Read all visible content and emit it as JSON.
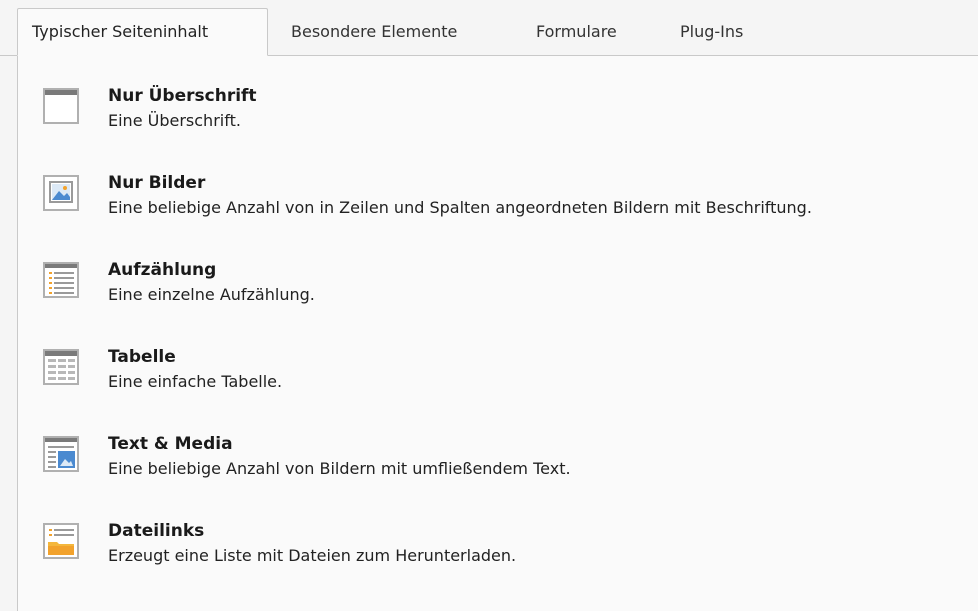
{
  "tabs": [
    {
      "label": "Typischer Seiteninhalt",
      "active": true
    },
    {
      "label": "Besondere Elemente",
      "active": false
    },
    {
      "label": "Formulare",
      "active": false
    },
    {
      "label": "Plug-Ins",
      "active": false
    }
  ],
  "items": [
    {
      "title": "Nur Überschrift",
      "description": "Eine Überschrift.",
      "icon": "header-icon"
    },
    {
      "title": "Nur Bilder",
      "description": "Eine beliebige Anzahl von in Zeilen und Spalten angeordneten Bildern mit Beschriftung.",
      "icon": "images-icon"
    },
    {
      "title": "Aufzählung",
      "description": "Eine einzelne Aufzählung.",
      "icon": "bullets-icon"
    },
    {
      "title": "Tabelle",
      "description": "Eine einfache Tabelle.",
      "icon": "table-icon"
    },
    {
      "title": "Text & Media",
      "description": "Eine beliebige Anzahl von Bildern mit umfließendem Text.",
      "icon": "textmedia-icon"
    },
    {
      "title": "Dateilinks",
      "description": "Erzeugt eine Liste mit Dateien zum Herunterladen.",
      "icon": "uploads-icon"
    }
  ],
  "colors": {
    "icon_frame": "#b0b0b0",
    "icon_bar": "#7a7a7a",
    "icon_image": "#4b8ad0",
    "icon_bullet": "#f2a22c",
    "icon_folder": "#f4b73c"
  }
}
